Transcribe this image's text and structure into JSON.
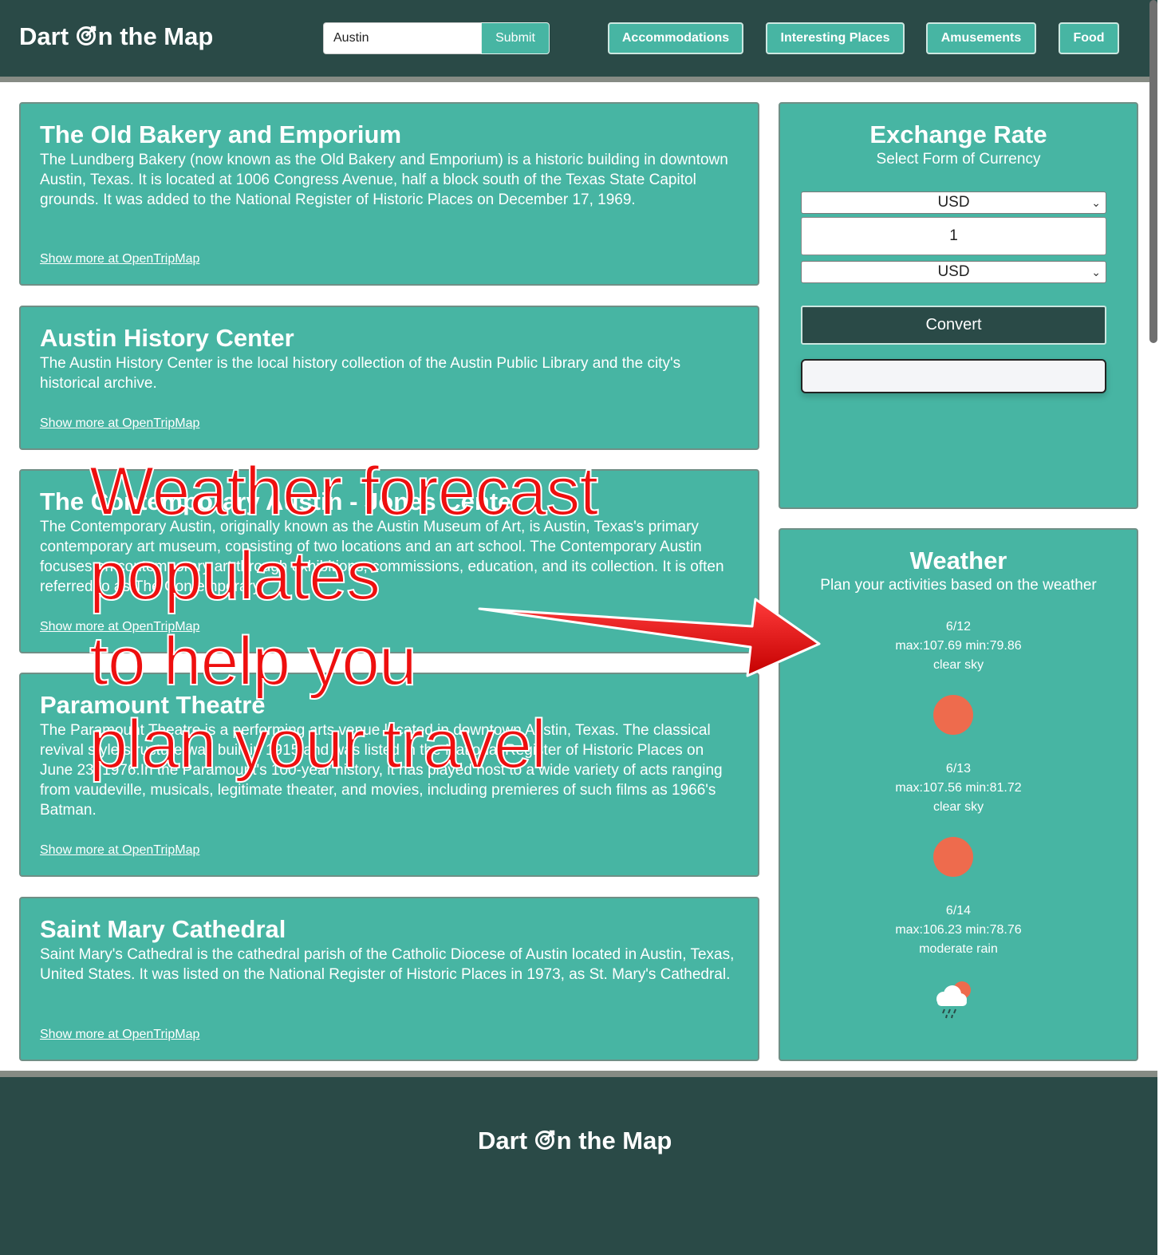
{
  "header": {
    "brand_prefix": "Dart ",
    "brand_suffix": "n the Map",
    "search_value": "Austin",
    "submit_label": "Submit",
    "nav": [
      "Accommodations",
      "Interesting Places",
      "Amusements",
      "Food"
    ]
  },
  "places": [
    {
      "title": "The Old Bakery and Emporium",
      "description": "The Lundberg Bakery (now known as the Old Bakery and Emporium) is a historic building in downtown Austin, Texas. It is located at 1006 Congress Avenue, half a block south of the Texas State Capitol grounds. It was added to the National Register of Historic Places on December 17, 1969.",
      "link": "Show more at OpenTripMap"
    },
    {
      "title": "Austin History Center",
      "description": "The Austin History Center is the local history collection of the Austin Public Library and the city's historical archive.",
      "link": "Show more at OpenTripMap"
    },
    {
      "title": "The Contemporary Austin - Jones Center",
      "description": "The Contemporary Austin, originally known as the Austin Museum of Art, is Austin, Texas's primary contemporary art museum, consisting of two locations and an art school. The Contemporary Austin focuses on contemporary art through exhibitions, commissions, education, and its collection. It is often referred to as The Contemporary.",
      "link": "Show more at OpenTripMap"
    },
    {
      "title": "Paramount Theatre",
      "description": "The Paramount Theatre is a performing arts venue located in downtown Austin, Texas. The classical revival style structure was built in 1915 and was listed in the National Register of Historic Places on June 23, 1976.In the Paramount's 100-year history, it has played host to a wide variety of acts ranging from vaudeville, musicals, legitimate theater, and movies, including premieres of such films as 1966's Batman.",
      "link": "Show more at OpenTripMap"
    },
    {
      "title": "Saint Mary Cathedral",
      "description": "Saint Mary's Cathedral is the cathedral parish of the Catholic Diocese of Austin located in Austin, Texas, United States. It was listed on the National Register of Historic Places in 1973, as St. Mary's Cathedral.",
      "link": "Show more at OpenTripMap"
    }
  ],
  "exchange": {
    "title": "Exchange Rate",
    "subtitle": "Select Form of Currency",
    "from_currency": "USD",
    "amount": "1",
    "to_currency": "USD",
    "convert_label": "Convert",
    "result": ""
  },
  "weather": {
    "title": "Weather",
    "subtitle": "Plan your activities based on the weather",
    "days": [
      {
        "date": "6/12",
        "temps": "max:107.69 min:79.86",
        "desc": "clear sky",
        "icon": "sun-icon"
      },
      {
        "date": "6/13",
        "temps": "max:107.56 min:81.72",
        "desc": "clear sky",
        "icon": "sun-icon"
      },
      {
        "date": "6/14",
        "temps": "max:106.23 min:78.76",
        "desc": "moderate rain",
        "icon": "rain-cloud-icon"
      }
    ]
  },
  "footer": {
    "brand_prefix": "Dart ",
    "brand_suffix": "n the Map"
  },
  "annotation": {
    "lines": [
      "Weather forecast",
      "populates",
      "to help you",
      "plan your travel"
    ],
    "color": "#ee0f0f"
  },
  "colors": {
    "header_bg": "#2a4a47",
    "card_bg": "#47b5a3",
    "sun": "#ee6b4d"
  }
}
